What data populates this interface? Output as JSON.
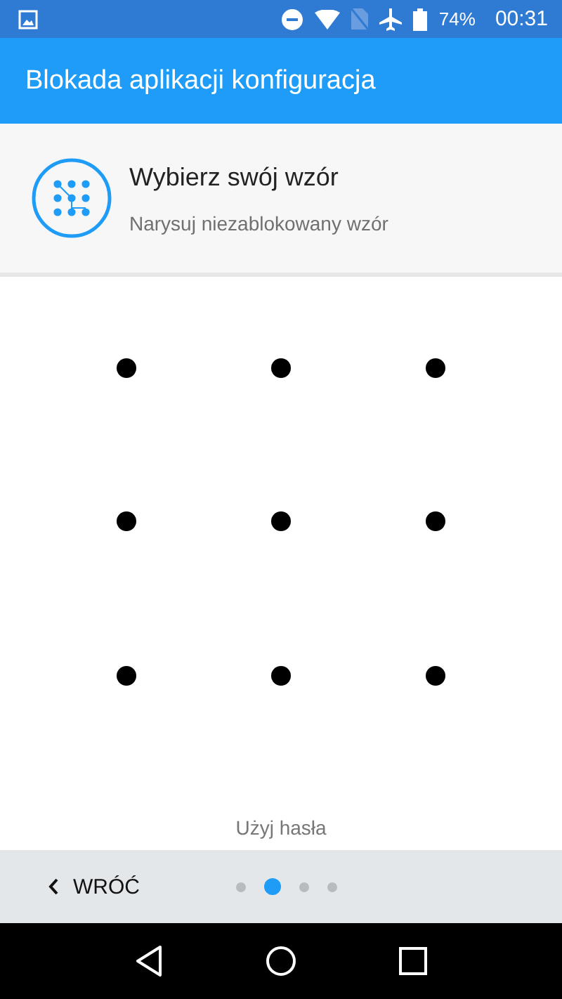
{
  "status_bar": {
    "battery_percent": "74%",
    "time": "00:31"
  },
  "app_bar": {
    "title": "Blokada aplikacji konfiguracja"
  },
  "header": {
    "title": "Wybierz swój wzór",
    "subtitle": "Narysuj niezablokowany wzór"
  },
  "pattern": {
    "dots": [
      {
        "selected": false
      },
      {
        "selected": false
      },
      {
        "selected": false
      },
      {
        "selected": false
      },
      {
        "selected": false
      },
      {
        "selected": false
      },
      {
        "selected": false
      },
      {
        "selected": false
      },
      {
        "selected": false
      }
    ]
  },
  "alternate_link": "Użyj hasła",
  "footer": {
    "back_button": "WRÓĆ",
    "steps": [
      {
        "selected": false
      },
      {
        "selected": true
      },
      {
        "selected": false
      },
      {
        "selected": false
      }
    ]
  }
}
